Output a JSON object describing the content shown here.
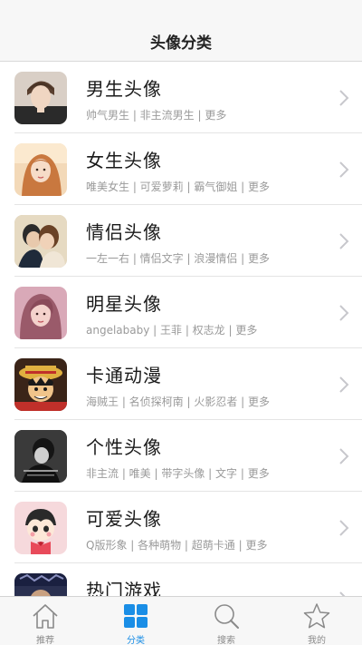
{
  "header": {
    "title": "头像分类"
  },
  "colors": {
    "accent": "#1a8ee6",
    "chevron": "#c7c7cc",
    "inactive": "#8a8a8a"
  },
  "categories": [
    {
      "title": "男生头像",
      "subtitle": "帅气男生 | 非主流男生 | 更多",
      "avatar": "male-avatar-photo"
    },
    {
      "title": "女生头像",
      "subtitle": "唯美女生 | 可爱萝莉 | 霸气御姐 | 更多",
      "avatar": "female-avatar-photo"
    },
    {
      "title": "情侣头像",
      "subtitle": "一左一右 | 情侣文字 | 浪漫情侣 | 更多",
      "avatar": "couple-avatar-photo"
    },
    {
      "title": "明星头像",
      "subtitle": "angelababy | 王菲 | 权志龙 | 更多",
      "avatar": "celebrity-avatar-photo"
    },
    {
      "title": "卡通动漫",
      "subtitle": "海贼王 | 名侦探柯南 | 火影忍者 | 更多",
      "avatar": "cartoon-avatar-image"
    },
    {
      "title": "个性头像",
      "subtitle": "非主流 | 唯美 | 带字头像 | 文字 | 更多",
      "avatar": "personality-avatar-image"
    },
    {
      "title": "可爱头像",
      "subtitle": "Q版形象 | 各种萌物 | 超萌卡通 | 更多",
      "avatar": "cute-avatar-image"
    },
    {
      "title": "热门游戏",
      "subtitle": "",
      "avatar": "game-avatar-image"
    }
  ],
  "tabbar": {
    "tabs": [
      {
        "label": "推荐",
        "icon": "home-icon",
        "active": false
      },
      {
        "label": "分类",
        "icon": "grid-icon",
        "active": true
      },
      {
        "label": "搜索",
        "icon": "search-icon",
        "active": false
      },
      {
        "label": "我的",
        "icon": "star-icon",
        "active": false
      }
    ]
  }
}
